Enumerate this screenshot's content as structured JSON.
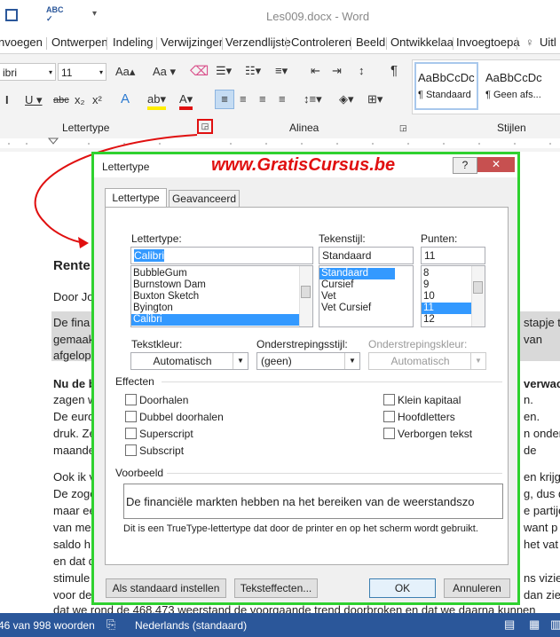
{
  "title": "Les009.docx - Word",
  "ribbon_tabs": [
    "nvoegen",
    "Ontwerpen",
    "Indeling",
    "Verwijzinger",
    "Verzendlijste",
    "Controleren",
    "Beeld",
    "Ontwikkelaa",
    "Invoegtoepa",
    "Uitl"
  ],
  "ribbon": {
    "font_name": "ibri",
    "font_size": "11",
    "grow_font": "Aa",
    "group_lettertype": "Lettertype",
    "group_alinea": "Alinea",
    "group_stijlen": "Stijlen",
    "style1_sample": "AaBbCcDc",
    "style1_name": "¶ Standaard",
    "style2_sample": "AaBbCcDc",
    "style2_name": "¶ Geen afs..."
  },
  "watermark": "www.GratisCursus.be",
  "document": {
    "heading": "Rente",
    "byline": "Door Jo",
    "lines_left": [
      "De fina",
      "gemaak",
      "afgelop",
      "Nu de b",
      "zagen w",
      "De euro",
      "druk. Ze",
      "maande",
      "Ook ik v",
      "De zogo",
      "maar ee",
      "van me",
      "saldo h",
      "en dat d",
      "stimule",
      "voor de",
      "dat we rond de 468.473 weerstand de voorgaande trend doorbroken en dat we daarna kunnen"
    ],
    "lines_right": [
      "stapje t",
      "van",
      "n.",
      "verwacl",
      "en.",
      "n onder",
      "de",
      "en krijg",
      "g, dus d",
      "e partije",
      "want p",
      "het vat",
      "ns vizie",
      "dan zier"
    ]
  },
  "status": {
    "words": "46 van 998 woorden",
    "language": "Nederlands (standaard)"
  },
  "dialog": {
    "title": "Lettertype",
    "tabs": [
      "Lettertype",
      "Geavanceerd"
    ],
    "font_label": "Lettertype:",
    "font_value": "Calibri",
    "font_list": [
      "BubbleGum",
      "Burnstown Dam",
      "Buxton Sketch",
      "Byington",
      "Calibri"
    ],
    "style_label": "Tekenstijl:",
    "style_value": "Standaard",
    "style_list": [
      "Standaard",
      "Cursief",
      "Vet",
      "Vet Cursief"
    ],
    "size_label": "Punten:",
    "size_value": "11",
    "size_list": [
      "8",
      "9",
      "10",
      "11",
      "12"
    ],
    "color_label": "Tekstkleur:",
    "color_value": "Automatisch",
    "underline_label": "Onderstrepingsstijl:",
    "underline_value": "(geen)",
    "underline_color_label": "Onderstrepingskleur:",
    "underline_color_value": "Automatisch",
    "effects_label": "Effecten",
    "effects_left": [
      "Doorhalen",
      "Dubbel doorhalen",
      "Superscript",
      "Subscript"
    ],
    "effects_right": [
      "Klein kapitaal",
      "Hoofdletters",
      "Verborgen tekst"
    ],
    "preview_label": "Voorbeeld",
    "preview_text": "De financiële markten hebben na het bereiken van de weerstandszo",
    "preview_note": "Dit is een TrueType-lettertype dat door de printer en op het scherm wordt gebruikt.",
    "btn_default": "Als standaard instellen",
    "btn_effects": "Teksteffecten...",
    "btn_ok": "OK",
    "btn_cancel": "Annuleren"
  },
  "colors": {
    "accent": "#2b579a",
    "dialog_border": "#2fd12f",
    "highlight": "#d9d9d9",
    "arrow": "#e01010",
    "watermark": "#e01010"
  }
}
